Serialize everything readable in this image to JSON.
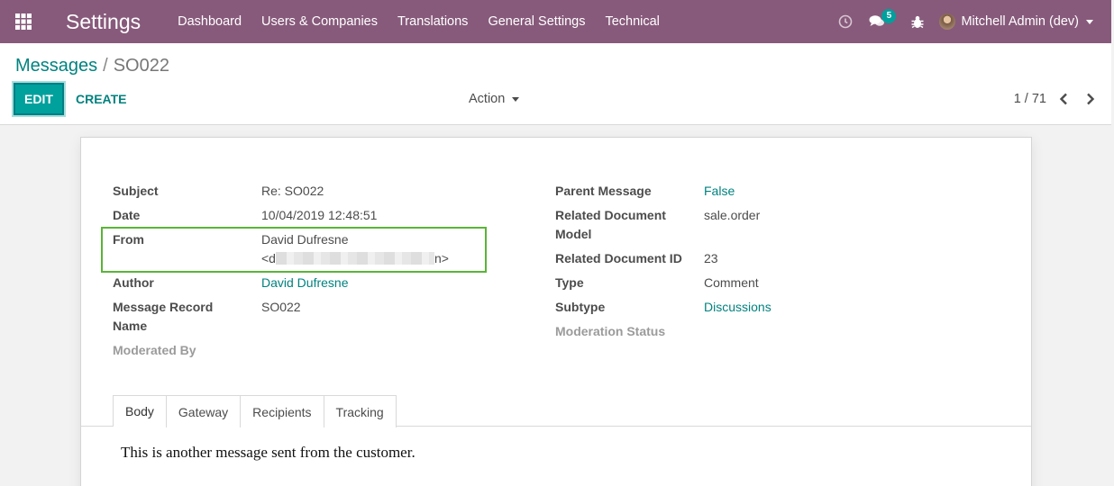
{
  "navbar": {
    "app_title": "Settings",
    "menu": [
      "Dashboard",
      "Users & Companies",
      "Translations",
      "General Settings",
      "Technical"
    ],
    "chat_count": "5",
    "user_name": "Mitchell Admin (dev)",
    "bg_color": "#875a7b"
  },
  "breadcrumb": {
    "parent": "Messages",
    "separator": "/",
    "current": "SO022"
  },
  "toolbar": {
    "edit_label": "EDIT",
    "create_label": "CREATE",
    "action_label": "Action",
    "pager": "1 / 71"
  },
  "form": {
    "left": [
      {
        "label": "Subject",
        "value": "Re: SO022"
      },
      {
        "label": "Date",
        "value": "10/04/2019 12:48:51"
      },
      {
        "label": "From",
        "value": "David Dufresne",
        "value2_prefix": "<d",
        "value2_suffix": "n>"
      },
      {
        "label": "Author",
        "value": "David Dufresne"
      },
      {
        "label": "Message Record",
        "label2": "Name",
        "value": "SO022"
      },
      {
        "label": "Moderated By",
        "value": ""
      }
    ],
    "right": [
      {
        "label": "Parent Message",
        "value": "False"
      },
      {
        "label": "Related Document",
        "label2": "Model",
        "value": "sale.order"
      },
      {
        "label": "Related Document ID",
        "value": "23"
      },
      {
        "label": "Type",
        "value": "Comment"
      },
      {
        "label": "Subtype",
        "value": "Discussions"
      },
      {
        "label": "Moderation Status",
        "value": ""
      }
    ]
  },
  "tabs": [
    "Body",
    "Gateway",
    "Recipients",
    "Tracking"
  ],
  "body_text": "This is another message sent from the customer.",
  "colors": {
    "accent": "#00a09d",
    "link": "#00827f",
    "highlight": "#5ab437"
  }
}
